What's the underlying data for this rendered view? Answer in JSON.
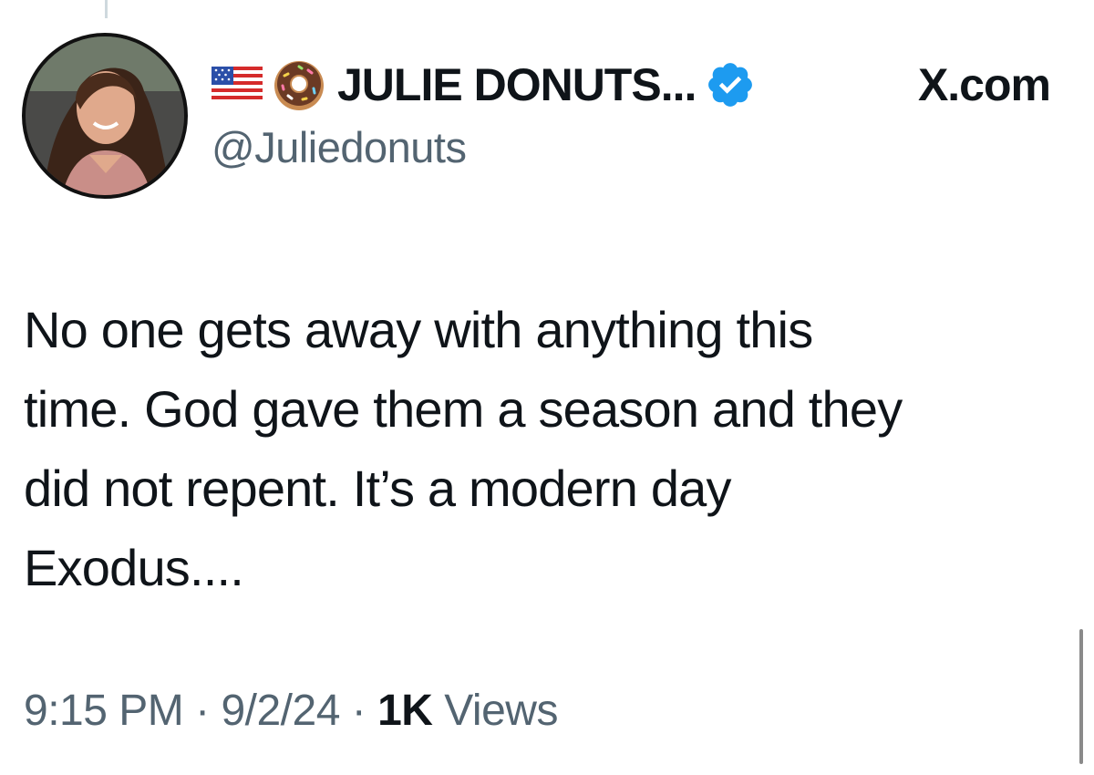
{
  "tweet": {
    "author": {
      "display_name": "JULIE DONUTS...",
      "handle": "@Juliedonuts",
      "name_emojis": [
        "us-flag-icon",
        "donut-icon"
      ],
      "verified": true
    },
    "site_label": "X.com",
    "text_lines": [
      "No one gets away with anything this",
      "time. God gave them a season and they",
      "did not repent. It’s a modern day",
      "Exodus...."
    ],
    "meta": {
      "time": "9:15 PM",
      "separator": "·",
      "date": "9/2/24",
      "views_count": "1K",
      "views_label": "Views"
    }
  },
  "colors": {
    "text_primary": "#0f1419",
    "text_secondary": "#536471",
    "verified_blue": "#1d9bf0"
  }
}
